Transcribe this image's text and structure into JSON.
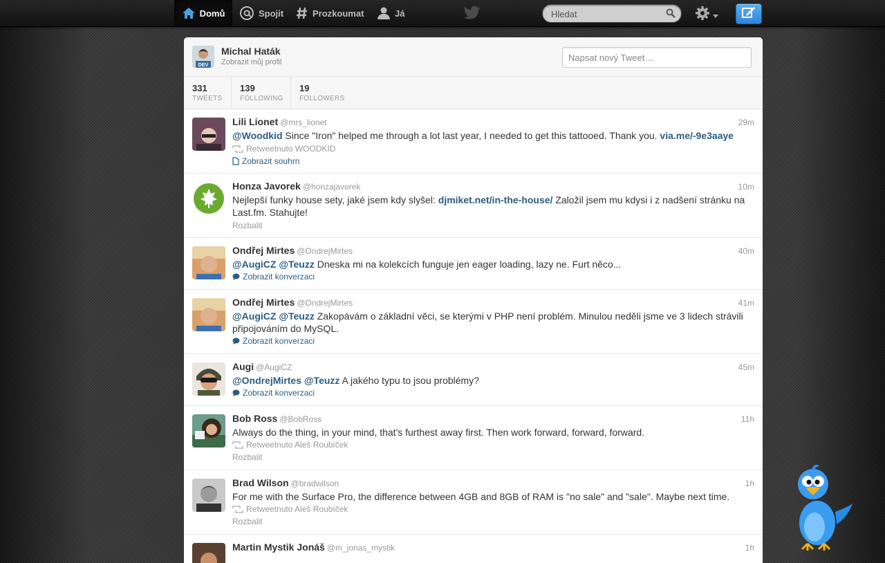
{
  "nav": {
    "home": "Domů",
    "connect": "Spojit",
    "discover": "Prozkoumat",
    "me": "Já"
  },
  "search": {
    "placeholder": "Hledat"
  },
  "profile": {
    "name": "Michal Haták",
    "link": "Zobrazit můj profil",
    "compose_placeholder": "Napsat nový Tweet…"
  },
  "stats": [
    {
      "value": "331",
      "label": "TWEETS"
    },
    {
      "value": "139",
      "label": "FOLLOWING"
    },
    {
      "value": "19",
      "label": "FOLLOWERS"
    }
  ],
  "tweets": [
    {
      "name": "Lili Lionet",
      "handle": "@mrs_lionet",
      "time": "29m",
      "parts": [
        "@Woodkid",
        " Since \"Iron\" helped me through a lot last year, I needed to get this tattooed. Thank you. ",
        "via.me/-9e3aaye"
      ],
      "retweet": "Retweetnuto WOODKID",
      "action": "Zobrazit souhrn"
    },
    {
      "name": "Honza Javorek",
      "handle": "@honzajavorek",
      "time": "10m",
      "parts": [
        "Nejlepší funky house sety, jaké jsem kdy slyšel: ",
        "djmiket.net/in-the-house/",
        " Založil jsem mu kdysi i z nadšení stránku na Last.fm. Stahujte!"
      ],
      "action": "Rozbalit"
    },
    {
      "name": "Ondřej Mirtes",
      "handle": "@OndrejMirtes",
      "time": "40m",
      "parts": [
        "@AugiCZ",
        " ",
        "@Teuzz",
        " Dneska mi na kolekcích funguje jen eager loading, lazy ne. Furt něco..."
      ],
      "action": "Zobrazit konverzaci"
    },
    {
      "name": "Ondřej Mirtes",
      "handle": "@OndrejMirtes",
      "time": "41m",
      "parts": [
        "@AugiCZ",
        " ",
        "@Teuzz",
        " Zakopávám o základní věci, se kterými v PHP není problém. Minulou neděli jsme ve 3 lidech strávili připojováním do MySQL."
      ],
      "action": "Zobrazit konverzaci"
    },
    {
      "name": "Augi",
      "handle": "@AugiCZ",
      "time": "45m",
      "parts": [
        "@OndrejMirtes",
        " ",
        "@Teuzz",
        " A jakého typu to jsou problémy?"
      ],
      "action": "Zobrazit konverzaci"
    },
    {
      "name": "Bob Ross",
      "handle": "@BobRoss",
      "time": "11h",
      "parts": [
        "Always do the thing, in your mind, that's furthest away first. Then work forward, forward, forward."
      ],
      "retweet": "Retweetnuto Aleš Roubíček",
      "action": "Rozbalit"
    },
    {
      "name": "Brad Wilson",
      "handle": "@bradwilson",
      "time": "1h",
      "parts": [
        "For me with the Surface Pro, the difference between 4GB and 8GB of RAM is \"no sale\" and \"sale\". Maybe next time."
      ],
      "retweet": "Retweetnuto Aleš Roubíček",
      "action": "Rozbalit"
    },
    {
      "name": "Martin Mystik Jonáš",
      "handle": "@m_jonas_mystik",
      "time": "1h"
    }
  ]
}
